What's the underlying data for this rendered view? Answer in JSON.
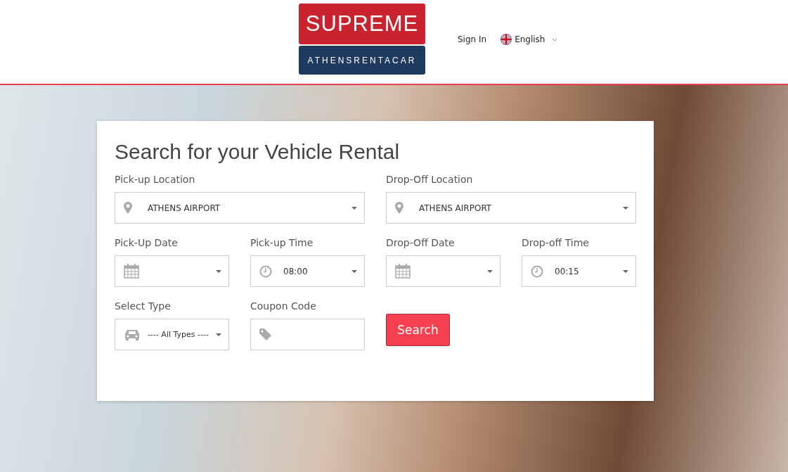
{
  "header": {
    "logo": {
      "brand": "SUPREME",
      "subtitle": "ATHENSRENTACAR"
    },
    "sign_in": "Sign In",
    "language": "English"
  },
  "search_form": {
    "title": "Search for your Vehicle Rental",
    "fields": [
      {
        "kind": "location",
        "label": "Pick-up Location",
        "value": "ATHENS AIRPORT"
      },
      {
        "kind": "location",
        "label": "Drop-Off Location",
        "value": "ATHENS AIRPORT"
      },
      {
        "kind": "date",
        "label": "Pick-Up Date"
      },
      {
        "kind": "time",
        "label": "Pick-up Time",
        "value": "08:00"
      },
      {
        "kind": "date",
        "label": "Drop-Off Date"
      },
      {
        "kind": "time",
        "label": "Drop-off Time",
        "value": "00:15"
      },
      {
        "kind": "type",
        "label": "Select Type",
        "value": "---- All Types ----"
      },
      {
        "kind": "coupon",
        "label": "Coupon Code"
      }
    ],
    "button": "Search"
  }
}
